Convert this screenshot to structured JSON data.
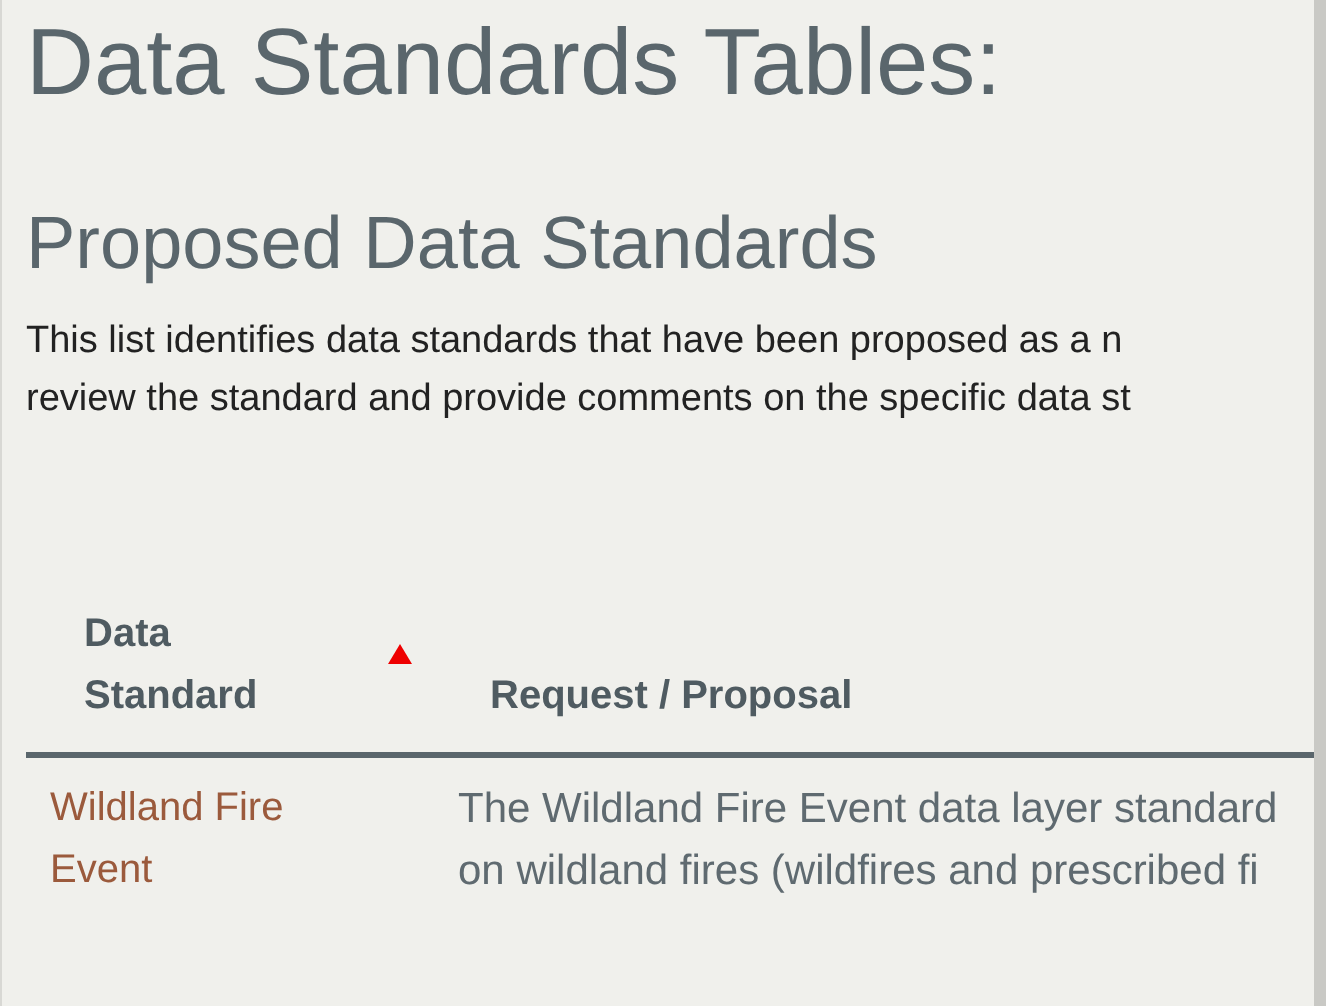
{
  "title": "Data Standards Tables:",
  "section": {
    "heading": "Proposed Data Standards",
    "intro_lines": [
      "This list identifies data standards that have been proposed as a n",
      "review the standard and provide comments on the specific data st"
    ]
  },
  "table": {
    "columns": [
      {
        "label_lines": [
          "Data",
          "Standard"
        ],
        "sorted": true
      },
      {
        "label_lines": [
          "Request / Proposal"
        ],
        "sorted": false
      }
    ],
    "rows": [
      {
        "name_lines": [
          "Wildland Fire",
          "Event"
        ],
        "description_lines": [
          "The Wildland Fire Event data layer standard",
          "on wildland fires (wildfires and prescribed fi"
        ]
      }
    ]
  }
}
